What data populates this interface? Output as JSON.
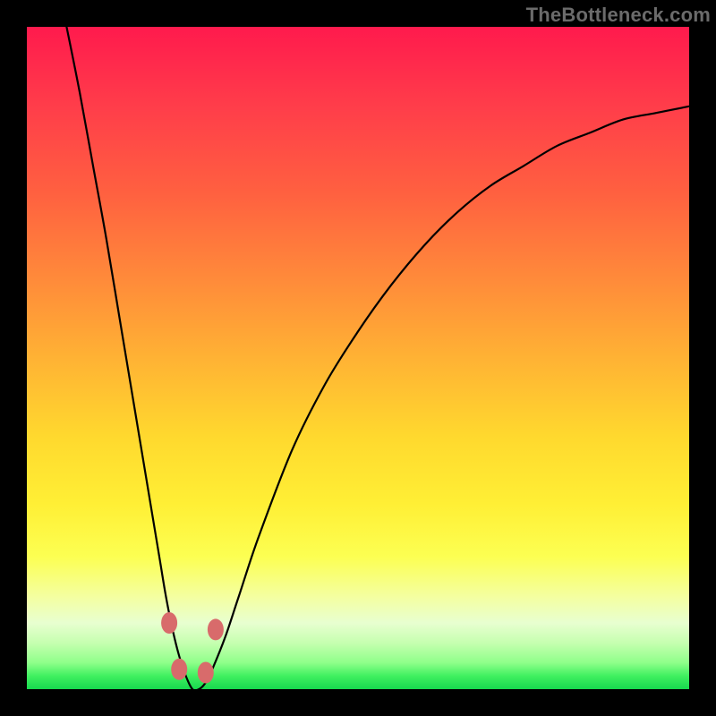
{
  "watermark": {
    "text": "TheBottleneck.com"
  },
  "chart_data": {
    "type": "line",
    "title": "",
    "xlabel": "",
    "ylabel": "",
    "xlim": [
      0,
      100
    ],
    "ylim": [
      0,
      100
    ],
    "grid": false,
    "legend": false,
    "colors": {
      "background_gradient_top": "#ff1a4d",
      "background_gradient_mid": "#ffd92e",
      "background_gradient_bottom": "#17d84e",
      "curve": "#000000",
      "dot": "#d86b6b"
    },
    "series": [
      {
        "name": "bottleneck-curve",
        "x": [
          6,
          8,
          10,
          12,
          14,
          16,
          18,
          20,
          21,
          22,
          23,
          24,
          25,
          26,
          27,
          28,
          30,
          32,
          35,
          40,
          45,
          50,
          55,
          60,
          65,
          70,
          75,
          80,
          85,
          90,
          95,
          100
        ],
        "y": [
          100,
          90,
          79,
          68,
          56,
          44,
          32,
          20,
          14,
          9,
          5,
          2,
          0,
          0,
          1,
          3,
          8,
          14,
          23,
          36,
          46,
          54,
          61,
          67,
          72,
          76,
          79,
          82,
          84,
          86,
          87,
          88
        ]
      }
    ],
    "annotations": [
      {
        "name": "trough-dot-left-upper",
        "x": 21.5,
        "y": 10
      },
      {
        "name": "trough-dot-left-lower",
        "x": 23,
        "y": 3
      },
      {
        "name": "trough-dot-right-lower",
        "x": 27,
        "y": 2.5
      },
      {
        "name": "trough-dot-right-upper",
        "x": 28.5,
        "y": 9
      }
    ]
  }
}
